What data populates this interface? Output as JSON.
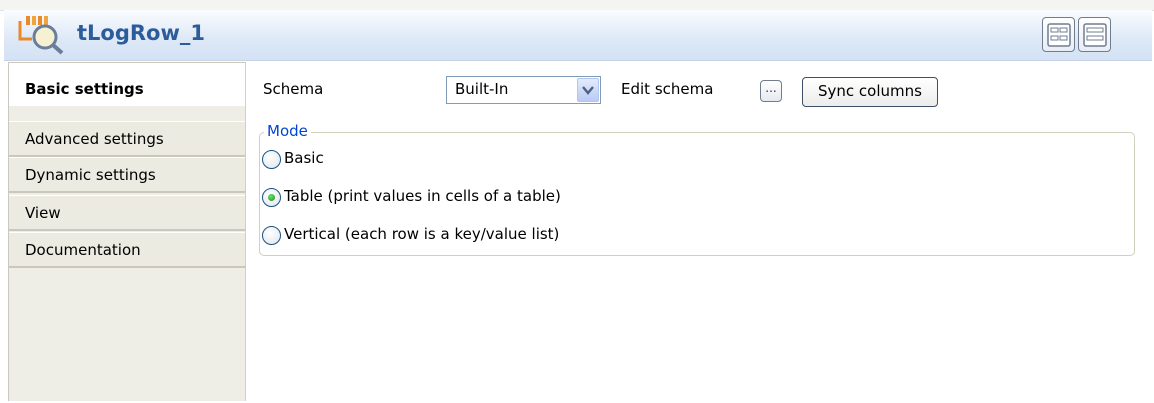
{
  "component": {
    "title": "tLogRow_1",
    "icon": "component-icon"
  },
  "toolbar": {
    "buttons": [
      "grid-layout-icon",
      "stacked-layout-icon"
    ]
  },
  "sidebar": {
    "items": [
      {
        "label": "Basic settings",
        "active": true
      },
      {
        "label": "Advanced settings"
      },
      {
        "label": "Dynamic settings"
      },
      {
        "label": "View"
      },
      {
        "label": "Documentation"
      }
    ]
  },
  "basic": {
    "schema_label": "Schema",
    "schema_value": "Built-In",
    "edit_schema_label": "Edit schema",
    "ellipsis_label": "...",
    "sync_label": "Sync columns",
    "mode": {
      "title": "Mode",
      "options": [
        {
          "label": "Basic",
          "checked": false
        },
        {
          "label": "Table (print values in cells of a table)",
          "checked": true
        },
        {
          "label": "Vertical (each row is a key/value list)",
          "checked": false
        }
      ]
    }
  },
  "colors": {
    "title": "#2d5c9a",
    "group_title": "#0046d5",
    "radio_checked": "#1c8a1c"
  }
}
